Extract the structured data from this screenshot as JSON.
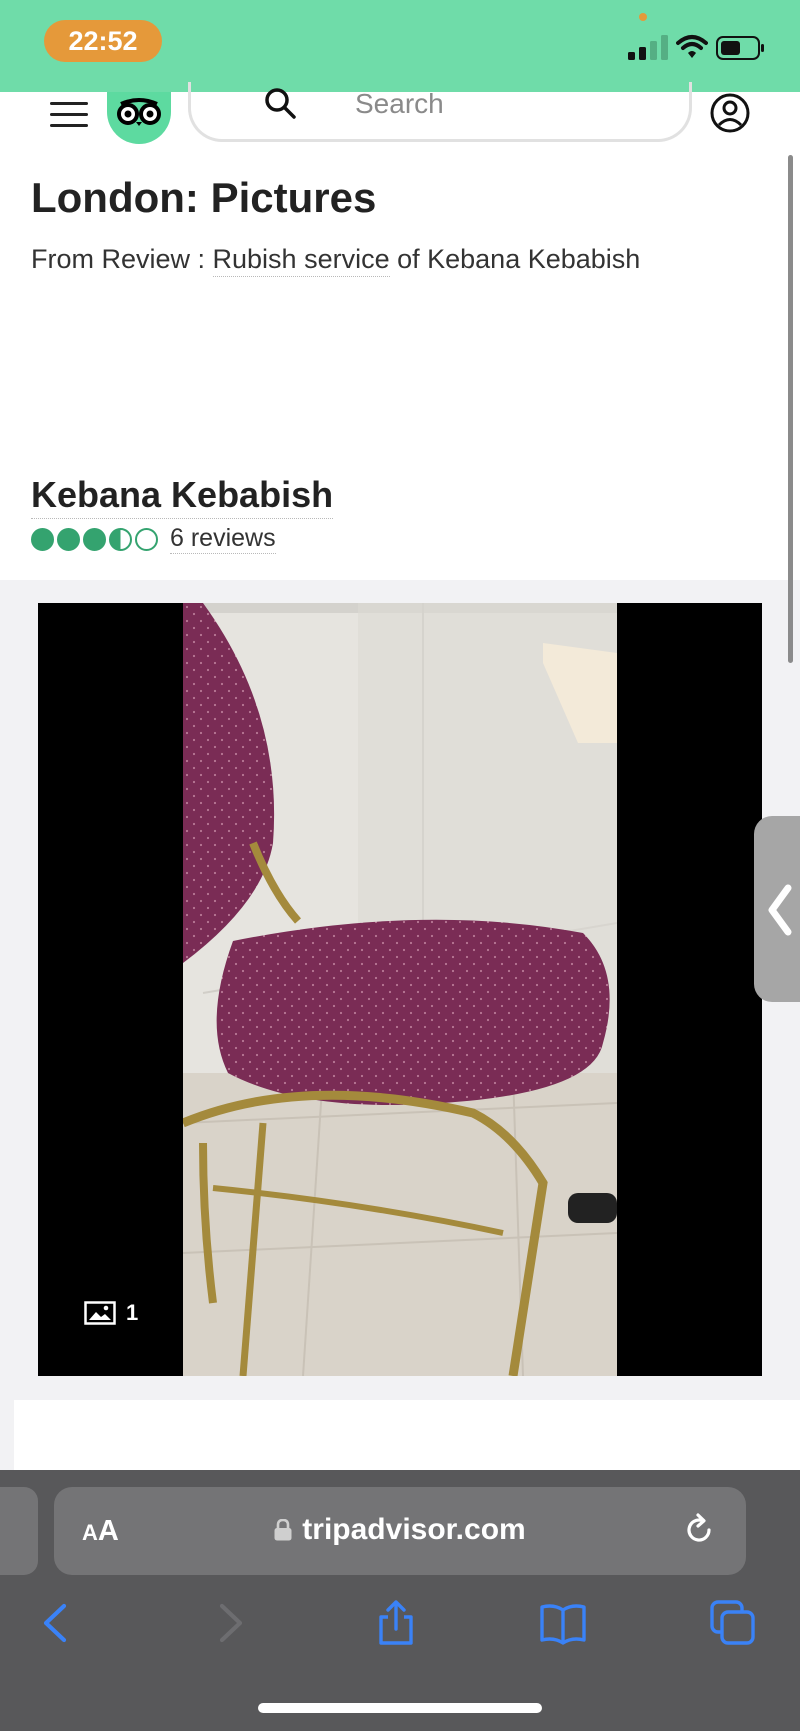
{
  "status_bar": {
    "time": "22:52",
    "colors": {
      "background": "#6fdca9",
      "time_pill": "#e5993a"
    },
    "icons": [
      "cellular-signal-icon",
      "wifi-icon",
      "battery-icon"
    ]
  },
  "header": {
    "menu_icon": "hamburger-menu-icon",
    "logo_icon": "tripadvisor-owl-logo",
    "search_placeholder": "Search",
    "account_icon": "user-account-icon"
  },
  "page": {
    "title": "London: Pictures",
    "from_review_prefix": "From Review : ",
    "review_title": "Rubish service",
    "review_suffix": " of Kebana Kebabish"
  },
  "restaurant": {
    "name": "Kebana Kebabish",
    "rating": 3.5,
    "rating_max": 5,
    "reviews_label": "6 reviews",
    "rating_color": "#34a36f"
  },
  "gallery": {
    "photo_count": "1",
    "photo_count_icon": "image-icon",
    "side_tab_icon": "chevron-left-icon"
  },
  "browser": {
    "text_size_label_small": "A",
    "text_size_label_big": "A",
    "url": "tripadvisor.com",
    "lock_icon": "lock-icon",
    "reload_icon": "reload-icon",
    "toolbar": [
      "back-icon",
      "forward-icon",
      "share-icon",
      "bookmarks-icon",
      "tabs-icon"
    ],
    "accent_color": "#3a82f7"
  }
}
